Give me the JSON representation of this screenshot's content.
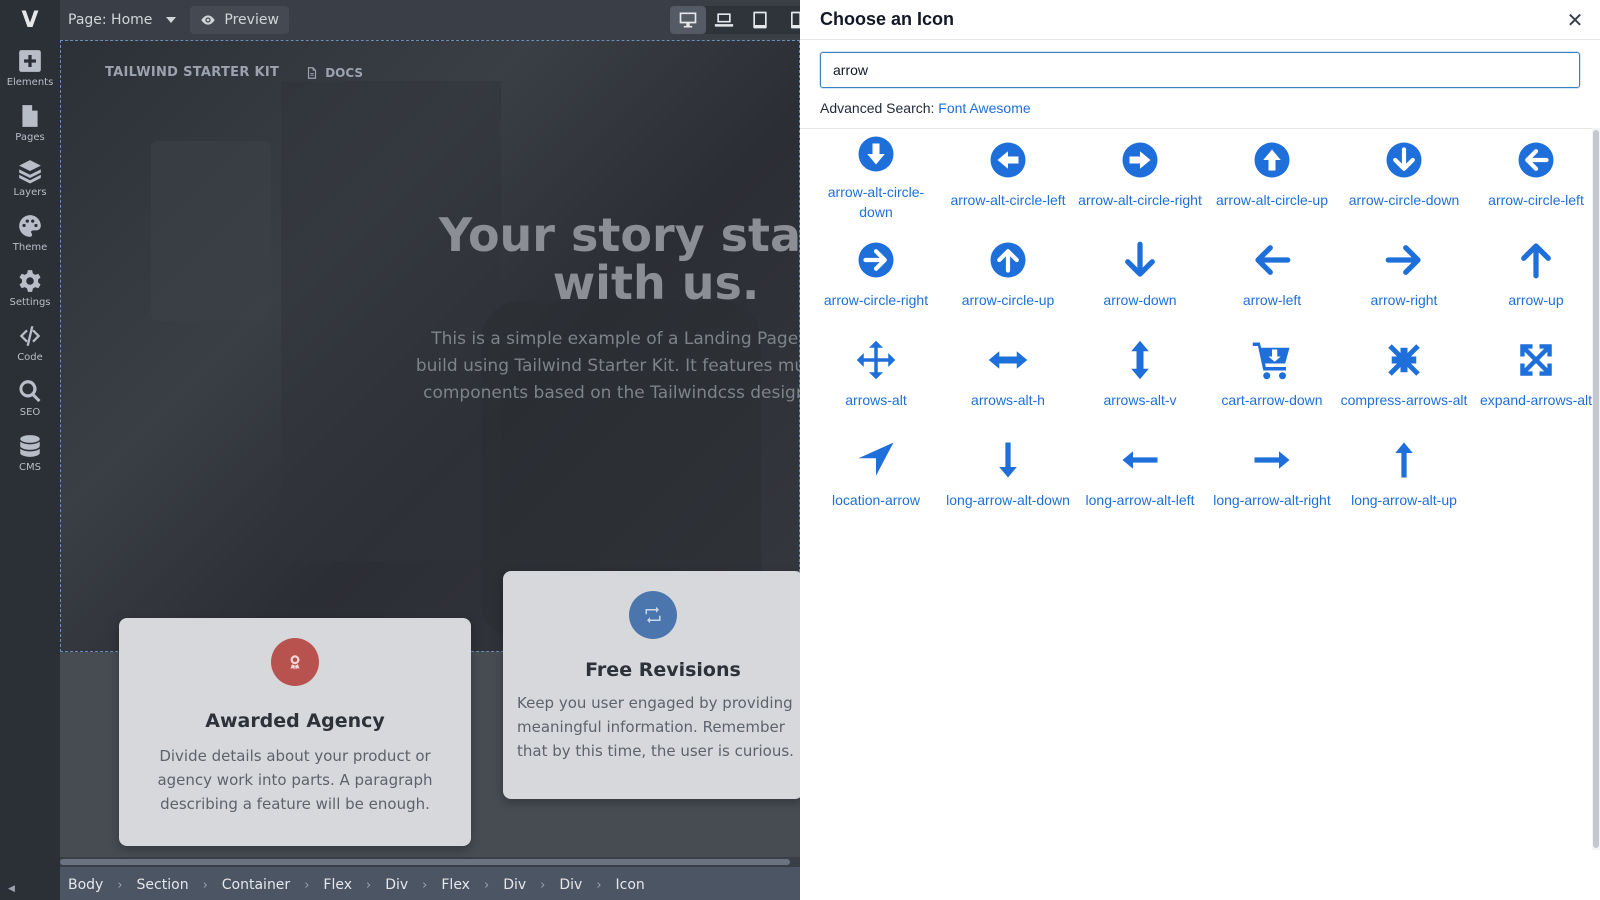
{
  "app": {
    "logo": "V"
  },
  "rail": {
    "items": [
      {
        "label": "Elements",
        "icon": "plus-square-icon"
      },
      {
        "label": "Pages",
        "icon": "file-icon"
      },
      {
        "label": "Layers",
        "icon": "layers-icon"
      },
      {
        "label": "Theme",
        "icon": "palette-icon"
      },
      {
        "label": "Settings",
        "icon": "gear-icon"
      },
      {
        "label": "Code",
        "icon": "code-icon"
      },
      {
        "label": "SEO",
        "icon": "search-icon"
      },
      {
        "label": "CMS",
        "icon": "database-icon"
      }
    ]
  },
  "topbar": {
    "page_select": "Page: Home",
    "preview_label": "Preview",
    "devices": [
      "desktop-icon",
      "laptop-icon",
      "tablet-icon",
      "mobile-icon"
    ]
  },
  "canvas": {
    "brand": "TAILWIND STARTER KIT",
    "docs": "DOCS",
    "hero_title": "Your story starts with us.",
    "hero_text": "This is a simple example of a Landing Page you can build using Tailwind Starter Kit. It features multiple CSS components based on the Tailwindcss design system.",
    "card1": {
      "title": "Awarded Agency",
      "text": "Divide details about your product or agency work into parts. A paragraph describing a feature will be enough."
    },
    "card2": {
      "title": "Free Revisions",
      "text": "Keep you user engaged by providing meaningful information. Remember that by this time, the user is curious."
    }
  },
  "breadcrumb": [
    "Body",
    "Section",
    "Container",
    "Flex",
    "Div",
    "Flex",
    "Div",
    "Div",
    "Icon"
  ],
  "modal": {
    "title": "Choose an Icon",
    "search_value": "arrow",
    "advanced_label": "Advanced Search:",
    "advanced_link": "Font Awesome",
    "accent_color": "#1e6fd9",
    "icons": [
      "arrow-alt-circle-down",
      "arrow-alt-circle-left",
      "arrow-alt-circle-right",
      "arrow-alt-circle-up",
      "arrow-circle-down",
      "arrow-circle-left",
      "arrow-circle-right",
      "arrow-circle-up",
      "arrow-down",
      "arrow-left",
      "arrow-right",
      "arrow-up",
      "arrows-alt",
      "arrows-alt-h",
      "arrows-alt-v",
      "cart-arrow-down",
      "compress-arrows-alt",
      "expand-arrows-alt",
      "location-arrow",
      "long-arrow-alt-down",
      "long-arrow-alt-left",
      "long-arrow-alt-right",
      "long-arrow-alt-up"
    ]
  }
}
